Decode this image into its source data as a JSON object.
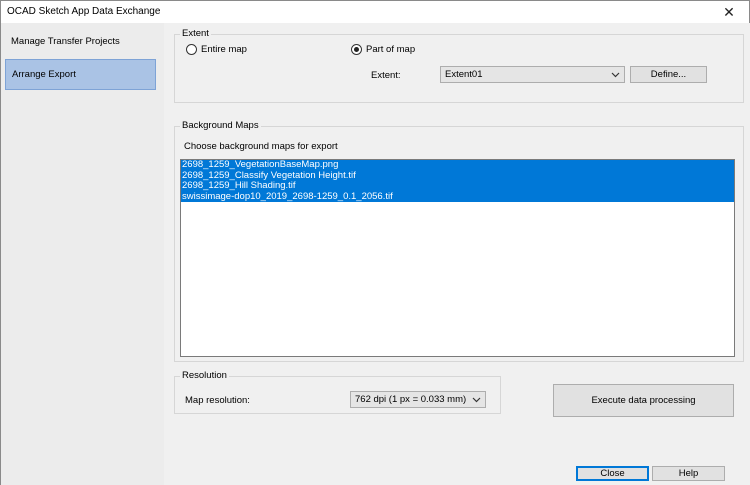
{
  "window": {
    "title": "OCAD Sketch App Data Exchange",
    "close_glyph": "✕"
  },
  "sidebar": {
    "items": [
      {
        "label": "Manage Transfer Projects",
        "selected": false
      },
      {
        "label": "Arrange Export",
        "selected": true
      }
    ]
  },
  "extent": {
    "group_title": "Extent",
    "radio_entire": "Entire map",
    "radio_part": "Part of map",
    "selected_option": "Part of map",
    "extent_label": "Extent:",
    "extent_value": "Extent01",
    "define_button": "Define..."
  },
  "background_maps": {
    "group_title": "Background Maps",
    "instruction": "Choose background maps for export",
    "items": [
      "2698_1259_VegetationBaseMap.png",
      "2698_1259_Classify Vegetation Height.tif",
      "2698_1259_Hill Shading.tif",
      "swissimage-dop10_2019_2698-1259_0.1_2056.tif"
    ]
  },
  "resolution": {
    "group_title": "Resolution",
    "label": "Map resolution:",
    "value": "762 dpi (1 px = 0.033 mm)"
  },
  "buttons": {
    "execute": "Execute data processing",
    "close": "Close",
    "help": "Help"
  },
  "colors": {
    "selection": "#0078d7",
    "sidebar_selected": "#aac3e5",
    "panel_bg": "#f0f0f0",
    "sidebar_bg": "#ececec"
  }
}
